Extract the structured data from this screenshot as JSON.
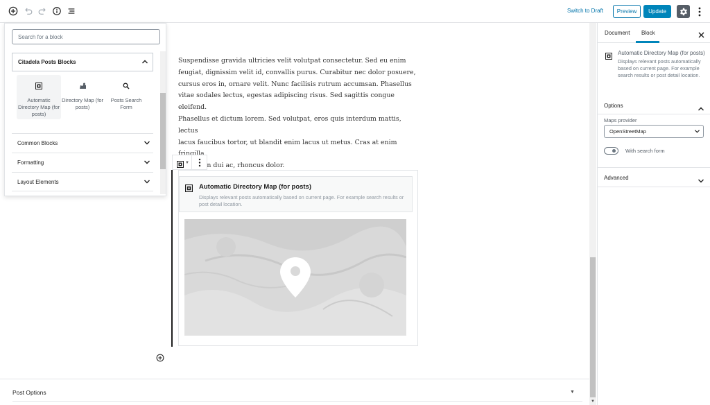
{
  "toolbar": {
    "add_block_icon": "plus-circle-icon",
    "undo_icon": "undo-icon",
    "redo_icon": "redo-icon",
    "info_icon": "info-icon",
    "outline_icon": "list-icon",
    "switch_to_draft": "Switch to Draft",
    "preview": "Preview",
    "update": "Update",
    "settings_icon": "gear-icon",
    "more_icon": "more-vertical-icon"
  },
  "inserter": {
    "search_placeholder": "Search for a block",
    "active_panel": "Citadela Posts Blocks",
    "blocks": [
      {
        "label": "Automatic Directory Map (for posts)",
        "icon": "map-block-icon"
      },
      {
        "label": "Directory Map (for posts)",
        "icon": "map-pins-icon"
      },
      {
        "label": "Posts Search Form",
        "icon": "search-icon"
      }
    ],
    "categories": [
      "Common Blocks",
      "Formatting",
      "Layout Elements"
    ]
  },
  "editor": {
    "paragraph": "Suspendisse gravida ultricies velit volutpat consectetur. Sed eu enim\nfeugiat, dignissim velit id, convallis purus. Curabitur nec dolor  posuere,\ncursus eros in, ornare velit. Nunc facilisis rutrum accumsan.  Phasellus\nvitae sodales lectus, egestas adipiscing risus. Sed sagittis  congue eleifend.\nPhasellus et dictum lorem. Sed volutpat, eros quis  interdum mattis, lectus\nlacus faucibus tortor, ut blandit enim lacus ut  metus. Cras at enim fringilla,\naccumsan dui ac, rhoncus dolor.",
    "map_block": {
      "title": "Automatic Directory Map (for posts)",
      "description": "Displays relevant posts automatically based on current page. For example search results or post detail location."
    },
    "post_options": "Post Options"
  },
  "sidebar": {
    "tabs": [
      "Document",
      "Block"
    ],
    "active_tab": "Block",
    "block_title": "Automatic Directory Map (for posts)",
    "block_description": "Displays relevant posts automatically based on current page. For example search results or post detail location.",
    "options_title": "Options",
    "maps_provider_label": "Maps provider",
    "maps_provider_value": "OpenStreetMap",
    "with_search_form": "With search form",
    "with_search_form_enabled": false,
    "advanced_title": "Advanced"
  },
  "colors": {
    "accent": "#0085ba",
    "link": "#0073aa",
    "border": "#e2e4e7"
  }
}
